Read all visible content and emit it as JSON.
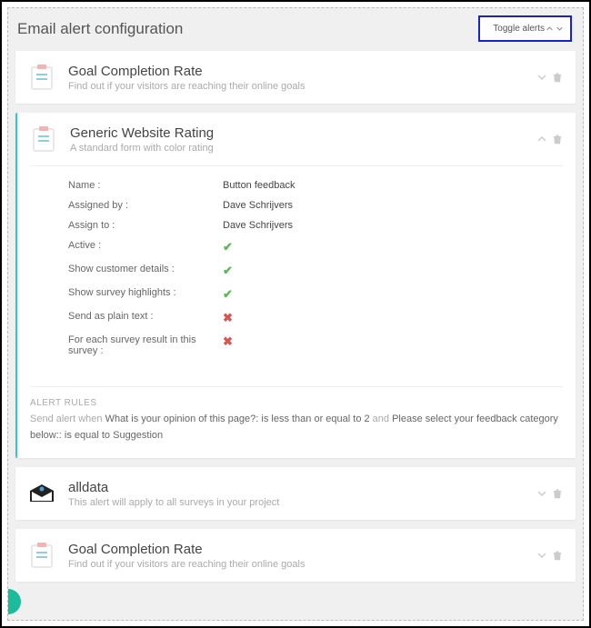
{
  "header": {
    "title": "Email alert configuration",
    "toggleLabel": "Toggle alerts"
  },
  "cards": [
    {
      "title": "Goal Completion Rate",
      "sub": "Find out if your visitors are reaching their online goals",
      "icon": "clipboard"
    },
    {
      "title": "Generic Website Rating",
      "sub": "A standard form with color rating",
      "icon": "clipboard",
      "expanded": true,
      "fields": {
        "nameLabel": "Name :",
        "nameVal": "Button feedback",
        "assignedByLabel": "Assigned by :",
        "assignedByVal": "Dave Schrijvers",
        "assignToLabel": "Assign to :",
        "assignToVal": "Dave Schrijvers",
        "activeLabel": "Active :",
        "custLabel": "Show customer details :",
        "highlightsLabel": "Show survey highlights :",
        "plainLabel": "Send as plain text :",
        "eachLabel": "For each survey result in this survey :"
      },
      "rules": {
        "heading": "ALERT RULES",
        "prefix": "Send alert when ",
        "cond1": "What is your opinion of this page?: is less than or equal to 2",
        "and": " and ",
        "cond2": "Please select your feedback category below:: is equal to Suggestion"
      }
    },
    {
      "title": "alldata",
      "sub": "This alert will apply to all surveys in your project",
      "icon": "envelope"
    },
    {
      "title": "Goal Completion Rate",
      "sub": "Find out if your visitors are reaching their online goals",
      "icon": "clipboard"
    }
  ]
}
